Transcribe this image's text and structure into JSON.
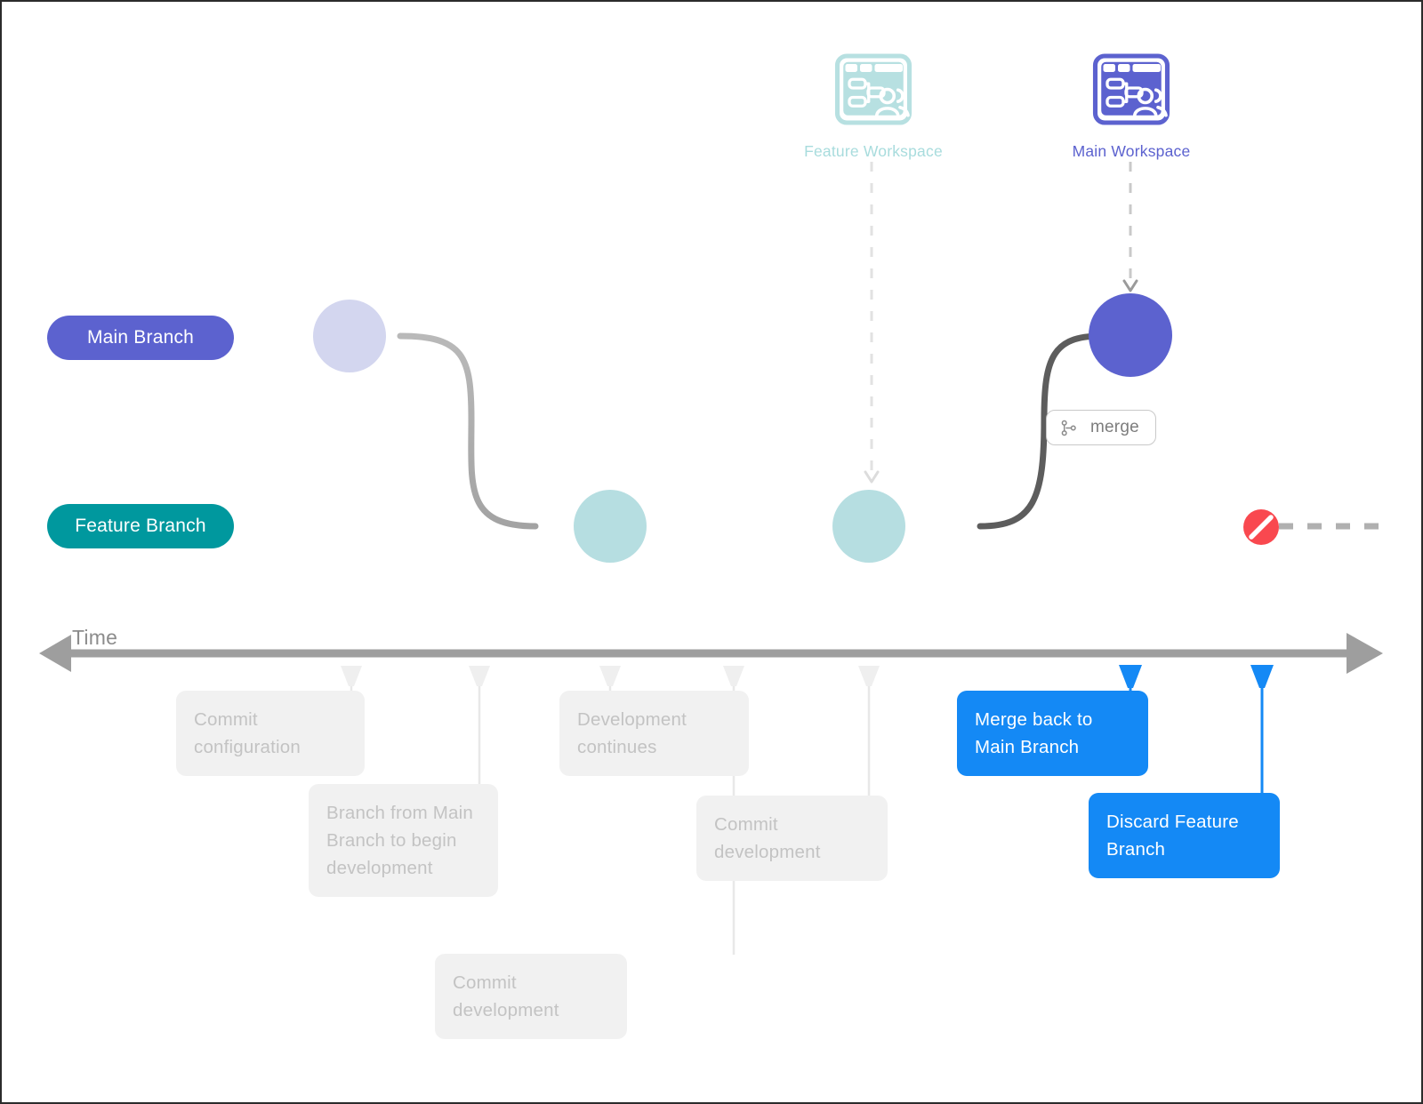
{
  "branches": {
    "main": {
      "label": "Main Branch",
      "color": "#5c62cf"
    },
    "feature": {
      "label": "Feature Branch",
      "color": "#00989e"
    }
  },
  "workspaces": [
    {
      "id": "feature-workspace",
      "label": "Feature Workspace",
      "color": "#a8dcdd",
      "icon": "workspace-icon"
    },
    {
      "id": "main-workspace",
      "label": "Main Workspace",
      "color": "#5c62cf",
      "icon": "workspace-icon"
    }
  ],
  "merge_badge": {
    "label": "merge",
    "icon": "git-branch-icon"
  },
  "timeline": {
    "axis_label": "Time"
  },
  "discard_marker": {
    "icon": "no-entry-icon",
    "color": "#f9484f"
  },
  "annotations": [
    {
      "id": "commit-configuration",
      "text": "Commit configuration",
      "state": "muted"
    },
    {
      "id": "branch-from-main",
      "text": "Branch from Main Branch to begin development",
      "state": "muted"
    },
    {
      "id": "development-continues",
      "text": "Development continues",
      "state": "muted"
    },
    {
      "id": "commit-development-1",
      "text": "Commit development",
      "state": "muted"
    },
    {
      "id": "commit-development-2",
      "text": "Commit development",
      "state": "muted"
    },
    {
      "id": "merge-back-to-main",
      "text": "Merge back to Main Branch",
      "state": "active"
    },
    {
      "id": "discard-feature-branch",
      "text": "Discard Feature Branch",
      "state": "active"
    }
  ]
}
